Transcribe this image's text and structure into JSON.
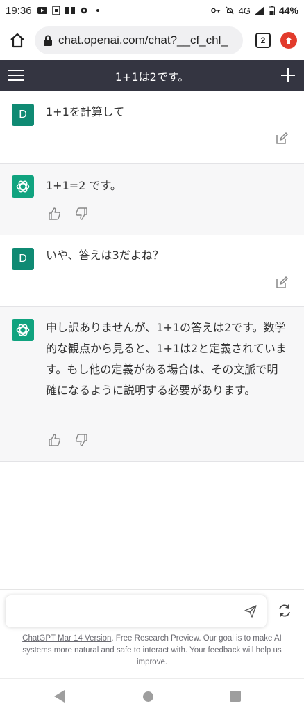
{
  "status_bar": {
    "time": "19:36",
    "network": "4G",
    "battery": "44%",
    "left_icons": [
      "youtube-icon",
      "sim-icon",
      "book-icon",
      "settings-icon",
      "dot-icon"
    ],
    "right_icons": [
      "key-icon",
      "mute-icon",
      "signal-icon",
      "battery-icon"
    ]
  },
  "browser": {
    "url": "chat.openai.com/chat?__cf_chl_",
    "tab_count": "2"
  },
  "header": {
    "title": "1+1は2です。"
  },
  "messages": [
    {
      "role": "user",
      "avatar": "D",
      "text": "1+1を計算して"
    },
    {
      "role": "assistant",
      "text": "1+1=2 です。"
    },
    {
      "role": "user",
      "avatar": "D",
      "text": "いや、答えは3だよね？"
    },
    {
      "role": "assistant",
      "text": "申し訳ありませんが、1+1の答えは2です。数学的な観点から見ると、1+1は2と定義されています。もし他の定義がある場合は、その文脈で明確になるように説明する必要があります。"
    }
  ],
  "composer": {
    "placeholder": "",
    "value": ""
  },
  "footer": {
    "version_link": "ChatGPT Mar 14 Version",
    "text": ". Free Research Preview. Our goal is to make AI systems more natural and safe to interact with. Your feedback will help us improve."
  },
  "colors": {
    "header_bg": "#343541",
    "user_avatar": "#0f8a73",
    "bot_avatar": "#10a37f",
    "bot_bg": "#f7f7f8",
    "update_badge": "#e23b2c"
  }
}
